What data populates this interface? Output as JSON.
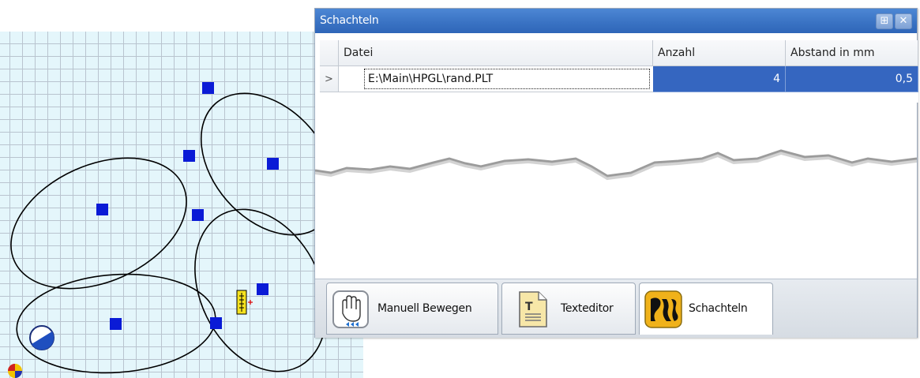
{
  "panel": {
    "title": "Schachteln",
    "pin_glyph": "⊞",
    "close_glyph": "✕",
    "table": {
      "columns": [
        "Datei",
        "Anzahl",
        "Abstand in mm"
      ],
      "row_indicator": ">",
      "rows": [
        {
          "file": "E:\\Main\\HPGL\\rand.PLT",
          "count": "4",
          "spacing": "0,5"
        }
      ]
    },
    "tabs": [
      {
        "label": "Manuell Bewegen",
        "icon": "hand-move-icon"
      },
      {
        "label": "Texteditor",
        "icon": "text-document-icon"
      },
      {
        "label": "Schachteln",
        "icon": "nesting-icon"
      }
    ],
    "active_tab": "Schachteln"
  },
  "canvas": {
    "grid": true,
    "shapes": "ellipses with nesting markers",
    "colors": {
      "background": "#e4f6fb",
      "marker": "#0a1bd6",
      "outline": "#000000",
      "selection": "#3566c0"
    }
  }
}
